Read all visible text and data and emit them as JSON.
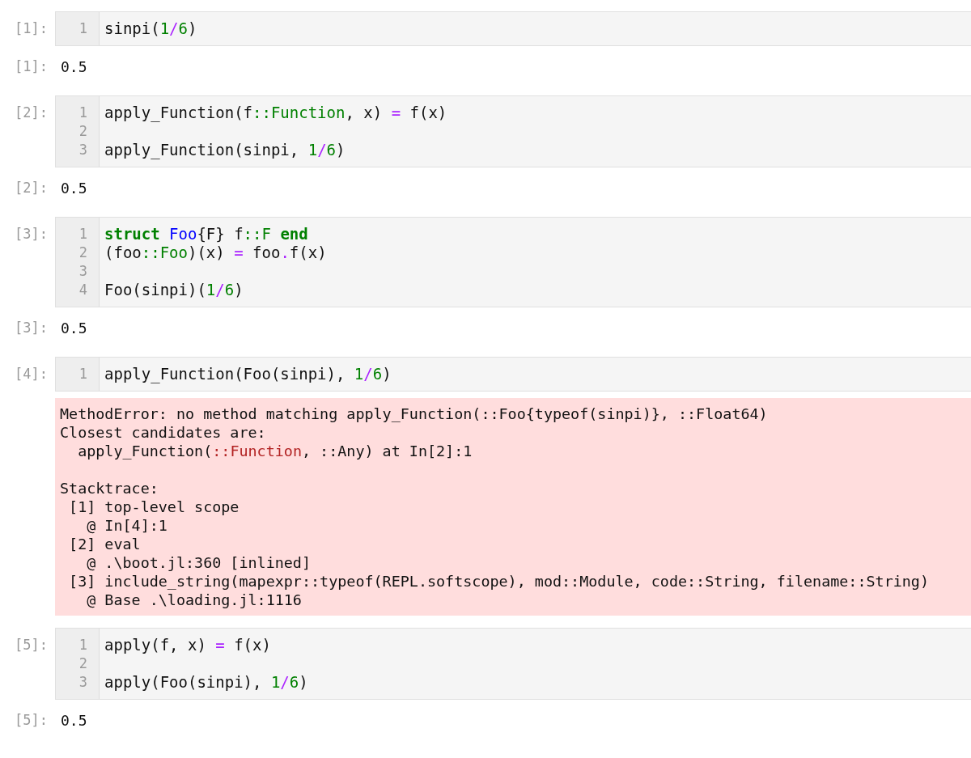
{
  "cells": [
    {
      "prompt": "[1]:",
      "lines": [
        {
          "n": "1",
          "tokens": [
            {
              "t": "sinpi("
            },
            {
              "t": "1",
              "kind": "num"
            },
            {
              "t": "/",
              "kind": "op"
            },
            {
              "t": "6",
              "kind": "num"
            },
            {
              "t": ")"
            }
          ]
        }
      ],
      "output": {
        "kind": "result",
        "prompt": "[1]:",
        "text": "0.5"
      }
    },
    {
      "prompt": "[2]:",
      "lines": [
        {
          "n": "1",
          "tokens": [
            {
              "t": "apply_Function(f"
            },
            {
              "t": "::Function",
              "kind": "type"
            },
            {
              "t": ", x) "
            },
            {
              "t": "=",
              "kind": "op"
            },
            {
              "t": " f(x)"
            }
          ]
        },
        {
          "n": "2"
        },
        {
          "n": "3",
          "tokens": [
            {
              "t": "apply_Function(sinpi, "
            },
            {
              "t": "1",
              "kind": "num"
            },
            {
              "t": "/",
              "kind": "op"
            },
            {
              "t": "6",
              "kind": "num"
            },
            {
              "t": ")"
            }
          ]
        }
      ],
      "output": {
        "kind": "result",
        "prompt": "[2]:",
        "text": "0.5"
      }
    },
    {
      "prompt": "[3]:",
      "lines": [
        {
          "n": "1",
          "tokens": [
            {
              "t": "struct ",
              "kind": "kw"
            },
            {
              "t": "Foo",
              "kind": "def"
            },
            {
              "t": "{F} f"
            },
            {
              "t": "::F",
              "kind": "type"
            },
            {
              "t": " end",
              "kind": "kw"
            }
          ]
        },
        {
          "n": "2",
          "tokens": [
            {
              "t": "(foo"
            },
            {
              "t": "::Foo",
              "kind": "type"
            },
            {
              "t": ")(x) "
            },
            {
              "t": "=",
              "kind": "op"
            },
            {
              "t": " foo"
            },
            {
              "t": ".",
              "kind": "op"
            },
            {
              "t": "f(x)"
            }
          ]
        },
        {
          "n": "3"
        },
        {
          "n": "4",
          "tokens": [
            {
              "t": "Foo(sinpi)("
            },
            {
              "t": "1",
              "kind": "num"
            },
            {
              "t": "/",
              "kind": "op"
            },
            {
              "t": "6",
              "kind": "num"
            },
            {
              "t": ")"
            }
          ]
        }
      ],
      "output": {
        "kind": "result",
        "prompt": "[3]:",
        "text": "0.5"
      }
    },
    {
      "prompt": "[4]:",
      "lines": [
        {
          "n": "1",
          "tokens": [
            {
              "t": "apply_Function(Foo(sinpi), "
            },
            {
              "t": "1",
              "kind": "num"
            },
            {
              "t": "/",
              "kind": "op"
            },
            {
              "t": "6",
              "kind": "num"
            },
            {
              "t": ")"
            }
          ]
        }
      ],
      "output": {
        "kind": "error",
        "lines": [
          {
            "kind": "text",
            "tokens": [
              {
                "t": "MethodError: no method matching apply_Function(::Foo{typeof(sinpi)}, ::Float64)"
              }
            ]
          },
          {
            "kind": "text",
            "tokens": [
              {
                "t": "Closest candidates are:"
              }
            ]
          },
          {
            "kind": "text",
            "tokens": [
              {
                "t": "  apply_Function("
              },
              {
                "t": "::Function",
                "kind": "err"
              },
              {
                "t": ", ::Any) at In[2]:1"
              }
            ]
          },
          {
            "kind": "blank"
          },
          {
            "kind": "text",
            "tokens": [
              {
                "t": "Stacktrace:"
              }
            ]
          },
          {
            "kind": "text",
            "tokens": [
              {
                "t": " [1] top-level scope"
              }
            ]
          },
          {
            "kind": "text",
            "tokens": [
              {
                "t": "   @ In[4]:1"
              }
            ]
          },
          {
            "kind": "text",
            "tokens": [
              {
                "t": " [2] eval"
              }
            ]
          },
          {
            "kind": "text",
            "tokens": [
              {
                "t": "   @ .\\boot.jl:360 [inlined]"
              }
            ]
          },
          {
            "kind": "text",
            "tokens": [
              {
                "t": " [3] include_string(mapexpr::typeof(REPL.softscope), mod::Module, code::String, filename::String)"
              }
            ]
          },
          {
            "kind": "text",
            "tokens": [
              {
                "t": "   @ Base .\\loading.jl:1116"
              }
            ]
          }
        ]
      }
    },
    {
      "prompt": "[5]:",
      "lines": [
        {
          "n": "1",
          "tokens": [
            {
              "t": "apply(f, x) "
            },
            {
              "t": "=",
              "kind": "op"
            },
            {
              "t": " f(x)"
            }
          ]
        },
        {
          "n": "2"
        },
        {
          "n": "3",
          "tokens": [
            {
              "t": "apply(Foo(sinpi), "
            },
            {
              "t": "1",
              "kind": "num"
            },
            {
              "t": "/",
              "kind": "op"
            },
            {
              "t": "6",
              "kind": "num"
            },
            {
              "t": ")"
            }
          ]
        }
      ],
      "output": {
        "kind": "result",
        "prompt": "[5]:",
        "text": "0.5"
      }
    }
  ]
}
